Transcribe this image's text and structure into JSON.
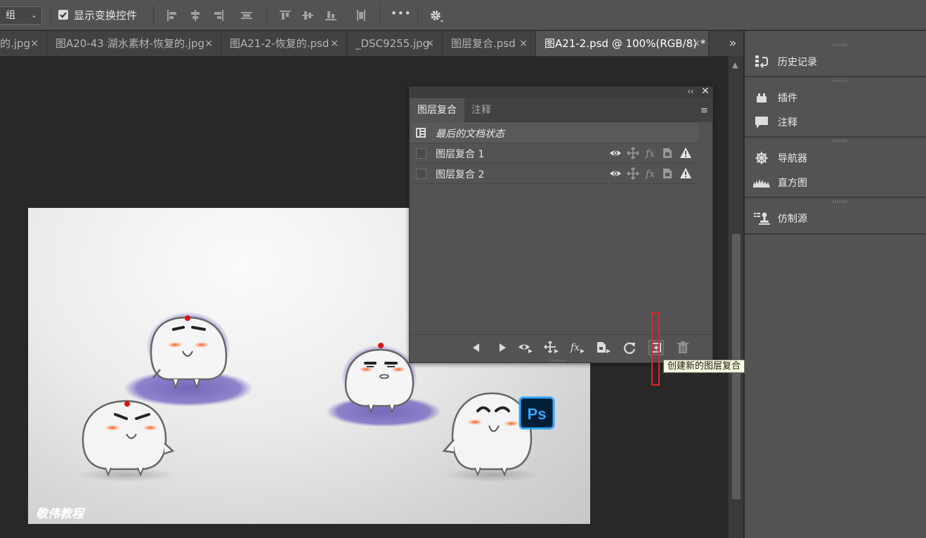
{
  "options_bar": {
    "select_value": "组",
    "select_caret": "⌄",
    "show_transform_label": "显示变换控件",
    "show_transform_checked": true,
    "more_label": "•••"
  },
  "tabs": [
    {
      "label": "的.jpg",
      "close": "×",
      "active": false
    },
    {
      "label": "图A20-43 湖水素材-恢复的.jpg",
      "close": "×",
      "active": false
    },
    {
      "label": "图A21-2-恢复的.psd",
      "close": "×",
      "active": false
    },
    {
      "label": "_DSC9255.jpg",
      "close": "×",
      "active": false
    },
    {
      "label": "图层复合.psd",
      "close": "×",
      "active": false
    },
    {
      "label": "图A21-2.psd @ 100%(RGB/8) *",
      "close": "×",
      "active": true
    }
  ],
  "tabs_overflow": "»",
  "canvas": {
    "watermark": "敬伟教程",
    "ps_badge": "Ps"
  },
  "dock": {
    "items": [
      {
        "label": "历史记录",
        "icon": "history-icon"
      },
      {
        "label": "插件",
        "icon": "plugins-icon"
      },
      {
        "label": "注释",
        "icon": "notes-icon"
      },
      {
        "label": "导航器",
        "icon": "navigator-icon"
      },
      {
        "label": "直方图",
        "icon": "histogram-icon"
      },
      {
        "label": "仿制源",
        "icon": "clone-source-icon"
      }
    ]
  },
  "layer_comps_panel": {
    "collapse": "‹‹",
    "close": "✕",
    "menu": "≡",
    "tabs": [
      {
        "label": "图层复合",
        "active": true
      },
      {
        "label": "注释",
        "active": false
      }
    ],
    "rows": [
      {
        "label": "最后的文档状态",
        "italic": true
      },
      {
        "label": "图层复合 1",
        "italic": false
      },
      {
        "label": "图层复合 2",
        "italic": false
      }
    ],
    "footer_buttons": [
      "previous-icon",
      "next-icon",
      "visibility-icon",
      "position-icon",
      "style-icon",
      "apply-comp-icon",
      "update-icon",
      "new-comp-icon",
      "delete-icon"
    ]
  },
  "tooltip": {
    "text": "创建新的图层复合"
  },
  "colors": {
    "accent_red": "#e0242a",
    "tooltip_bg": "#ffffe1",
    "ps_blue": "#31a8ff",
    "ps_dark": "#001e36"
  }
}
